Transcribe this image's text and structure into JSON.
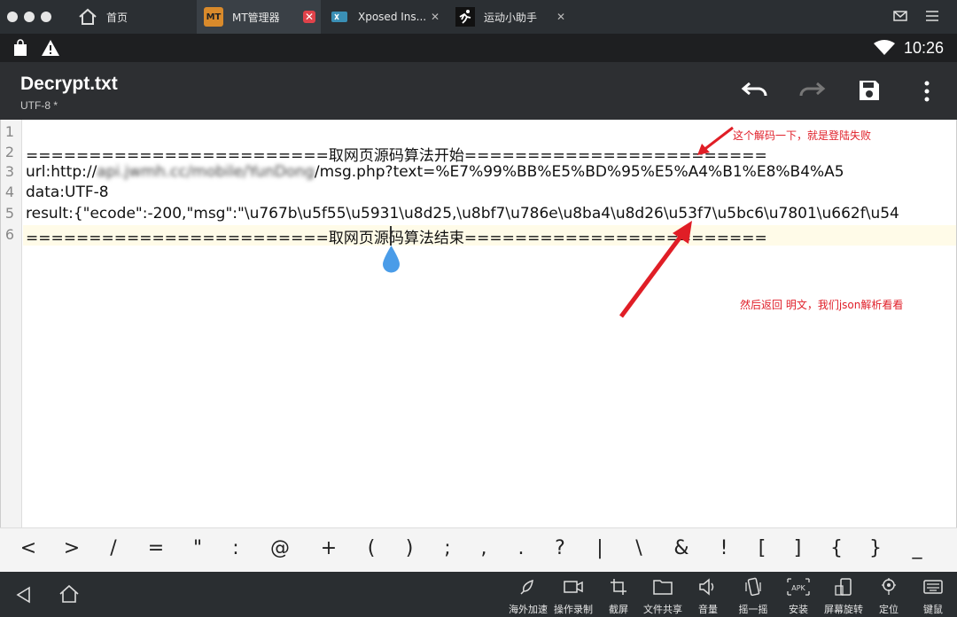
{
  "tabs": [
    {
      "label": "首页",
      "icon": "home-icon"
    },
    {
      "label": "MT管理器",
      "icon": "mt-manager-icon",
      "active": true
    },
    {
      "label": "Xposed Ins...",
      "icon": "xposed-icon"
    },
    {
      "label": "运动小助手",
      "icon": "runner-icon"
    }
  ],
  "status": {
    "time": "10:26"
  },
  "appbar": {
    "title": "Decrypt.txt",
    "subtitle": "UTF-8 *"
  },
  "editor": {
    "line_numbers": [
      "1",
      "2",
      "3",
      "4",
      "5",
      "6"
    ],
    "lines": [
      "",
      "========================取网页源码算法开始========================",
      "url:http://",
      "data:UTF-8",
      "result:{\"ecode\":-200,\"msg\":\"\\u767b\\u5f55\\u5931\\u8d25,\\u8bf7\\u786e\\u8ba4\\u8d26\\u53f7\\u5bc6\\u7801\\u662f\\u54",
      "========================取网页源码算法结束========================"
    ],
    "line3_blurred": "api.jwmh.cc/mobile/YunDong",
    "line3_tail": "/msg.php?text=%E7%99%BB%E5%BD%95%E5%A4%B1%E8%B4%A5"
  },
  "annotations": {
    "top": "这个解码一下，就是登陆失败",
    "bottom": "然后返回 明文，我们json解析看看"
  },
  "symbols": [
    "<",
    ">",
    "/",
    "=",
    "\"",
    ":",
    "@",
    "+",
    "(",
    ")",
    ";",
    ",",
    ".",
    "?",
    "|",
    "\\",
    "&",
    "!",
    "[",
    "]",
    "{",
    "}",
    "_"
  ],
  "toolbar": [
    {
      "label": "海外加速",
      "icon": "rocket-icon"
    },
    {
      "label": "操作录制",
      "icon": "video-record-icon"
    },
    {
      "label": "截屏",
      "icon": "crop-icon"
    },
    {
      "label": "文件共享",
      "icon": "folder-icon"
    },
    {
      "label": "音量",
      "icon": "volume-icon"
    },
    {
      "label": "摇一摇",
      "icon": "shake-icon"
    },
    {
      "label": "安装",
      "icon": "apk-install-icon"
    },
    {
      "label": "屏幕旋转",
      "icon": "rotate-screen-icon"
    },
    {
      "label": "定位",
      "icon": "location-icon"
    },
    {
      "label": "键鼠",
      "icon": "keyboard-mouse-icon"
    }
  ]
}
